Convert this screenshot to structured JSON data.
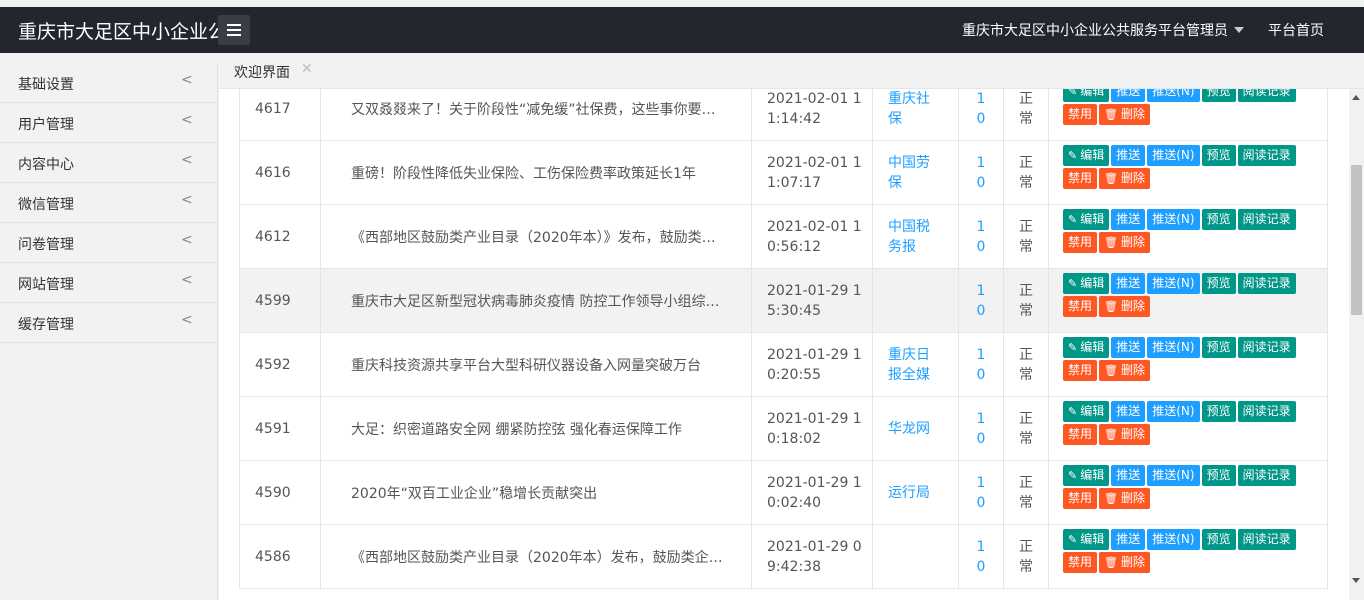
{
  "header": {
    "brand": "重庆市大足区中小企业公",
    "admin_name": "重庆市大足区中小企业公共服务平台管理员",
    "home_link": "平台首页"
  },
  "sidebar": {
    "items": [
      {
        "label": "基础设置"
      },
      {
        "label": "用户管理"
      },
      {
        "label": "内容中心"
      },
      {
        "label": "微信管理"
      },
      {
        "label": "问卷管理"
      },
      {
        "label": "网站管理"
      },
      {
        "label": "缓存管理"
      }
    ]
  },
  "tabs": {
    "active": "欢迎界面",
    "close": "✕"
  },
  "buttons": {
    "edit": "编辑",
    "push": "推送",
    "push_n": "推送(N)",
    "preview": "预览",
    "read_log": "阅读记录",
    "disable": "禁用",
    "delete": "删除"
  },
  "rows": [
    {
      "id": "4617",
      "title": "又双叒叕来了！关于阶段性“减免缓”社保费，这些事你要…",
      "date1": "2021-02-01 1",
      "date2": "1:14:42",
      "src1": "重庆社",
      "src2": "保",
      "read1": "1",
      "read2": "0",
      "stat1": "正",
      "stat2": "常"
    },
    {
      "id": "4616",
      "title": "重磅！阶段性降低失业保险、工伤保险费率政策延长1年",
      "date1": "2021-02-01 1",
      "date2": "1:07:17",
      "src1": "中国劳",
      "src2": "保",
      "read1": "1",
      "read2": "0",
      "stat1": "正",
      "stat2": "常"
    },
    {
      "id": "4612",
      "title": "《西部地区鼓励类产业目录（2020年本）》发布，鼓励类…",
      "date1": "2021-02-01 1",
      "date2": "0:56:12",
      "src1": "中国税",
      "src2": "务报",
      "read1": "1",
      "read2": "0",
      "stat1": "正",
      "stat2": "常"
    },
    {
      "id": "4599",
      "title": "重庆市大足区新型冠状病毒肺炎疫情 防控工作领导小组综…",
      "date1": "2021-01-29 1",
      "date2": "5:30:45",
      "src1": "",
      "src2": "",
      "read1": "1",
      "read2": "0",
      "stat1": "正",
      "stat2": "常"
    },
    {
      "id": "4592",
      "title": "重庆科技资源共享平台大型科研仪器设备入网量突破万台",
      "date1": "2021-01-29 1",
      "date2": "0:20:55",
      "src1": "重庆日",
      "src2": "报全媒",
      "read1": "1",
      "read2": "0",
      "stat1": "正",
      "stat2": "常"
    },
    {
      "id": "4591",
      "title": "大足：织密道路安全网 绷紧防控弦 强化春运保障工作",
      "date1": "2021-01-29 1",
      "date2": "0:18:02",
      "src1": "华龙网",
      "src2": "",
      "read1": "1",
      "read2": "0",
      "stat1": "正",
      "stat2": "常"
    },
    {
      "id": "4590",
      "title": "2020年“双百工业企业”稳增长贡献突出",
      "date1": "2021-01-29 1",
      "date2": "0:02:40",
      "src1": "运行局",
      "src2": "",
      "read1": "1",
      "read2": "0",
      "stat1": "正",
      "stat2": "常"
    },
    {
      "id": "4586",
      "title": "《西部地区鼓励类产业目录（2020年本）发布，鼓励类企…",
      "date1": "2021-01-29 0",
      "date2": "9:42:38",
      "src1": "",
      "src2": "",
      "read1": "1",
      "read2": "0",
      "stat1": "正",
      "stat2": "常"
    }
  ],
  "colors": {
    "header_bg": "#23262e",
    "teal": "#009688",
    "blue": "#1e9fff",
    "orange": "#ff5722"
  }
}
